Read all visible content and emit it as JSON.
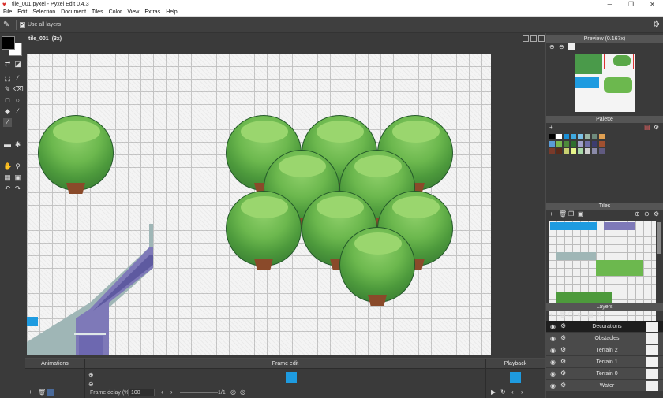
{
  "window": {
    "title": "tile_001.pyxel - Pyxel Edit 0.4.3",
    "min_glyph": "─",
    "max_glyph": "❐",
    "close_glyph": "✕"
  },
  "menu": [
    "File",
    "Edit",
    "Selection",
    "Document",
    "Tiles",
    "Color",
    "View",
    "Extras",
    "Help"
  ],
  "toolbar": {
    "use_all_layers": "Use all layers"
  },
  "canvas": {
    "title": "tile_001",
    "zoom": "(3x)"
  },
  "preview": {
    "title": "Preview (0.167x)"
  },
  "palette": {
    "title": "Palette",
    "swatches": [
      "#000000",
      "#ffffff",
      "#1a8fd6",
      "#3fa9e0",
      "#7cc2e8",
      "#9bb7a6",
      "#6f8b7d",
      "#e0a052",
      "#5a9bd6",
      "#7ab84e",
      "#4d8a3a",
      "#2f6e2f",
      "#a0a0c8",
      "#6e6ea6",
      "#3c3c6e",
      "#a05030",
      "#7a3a2a",
      "#5a2a1a",
      "#c8d070",
      "#e6f48a",
      "#a8d8a8",
      "#d0d0d0",
      "#8a8aa8",
      "#605a80"
    ]
  },
  "tiles": {
    "title": "Tiles"
  },
  "layers": {
    "title": "Layers",
    "items": [
      {
        "name": "Decorations",
        "selected": true
      },
      {
        "name": "Obstacles",
        "selected": false
      },
      {
        "name": "Terrain 2",
        "selected": false
      },
      {
        "name": "Terrain 1",
        "selected": false
      },
      {
        "name": "Terrain 0",
        "selected": false
      },
      {
        "name": "Water",
        "selected": false
      }
    ]
  },
  "animations": {
    "title": "Animations"
  },
  "frame_edit": {
    "title": "Frame edit",
    "frame_delay_label": "Frame delay (%)",
    "frame_delay_value": "100",
    "frame_count": "1/1"
  },
  "playback": {
    "title": "Playback"
  },
  "colors": {
    "accent": "#1e9be0",
    "panel": "#3a3a3a"
  }
}
